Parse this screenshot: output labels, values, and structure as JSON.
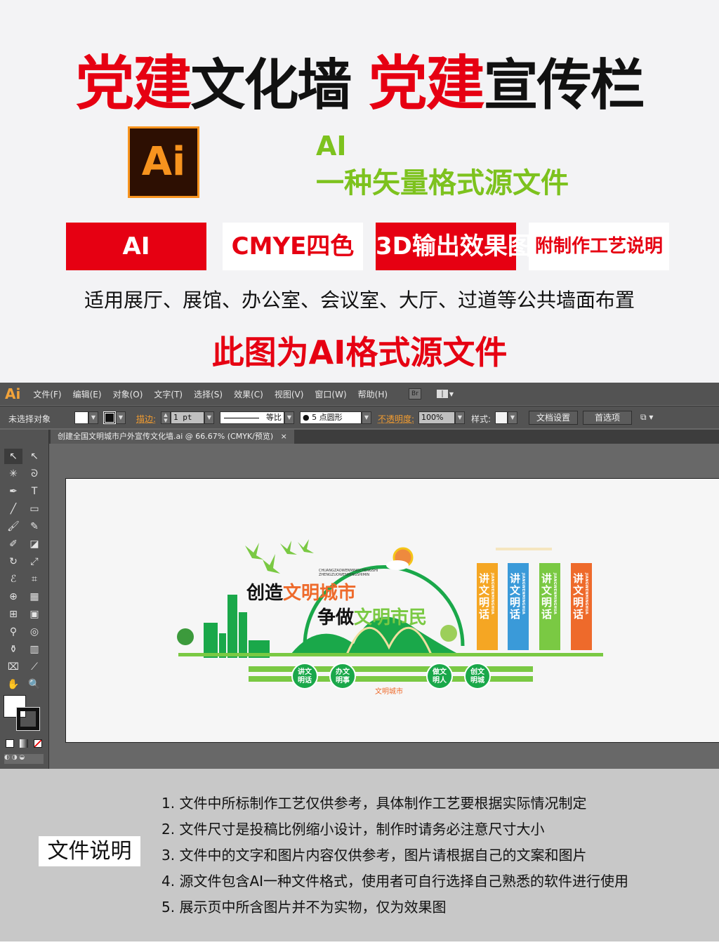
{
  "header": {
    "title_red1": "党建",
    "title_black1": "文化墙",
    "title_red2": "党建",
    "title_black2": "宣传栏"
  },
  "logo": {
    "text": "Ai"
  },
  "intro": {
    "line1": "AI",
    "line2": "一种矢量格式源文件"
  },
  "tags": [
    "AI",
    "CMYE四色",
    "3D输出效果图",
    "附制作工艺说明"
  ],
  "usage": "适用展厅、展馆、办公室、会议室、大厅、过道等公共墙面布置",
  "source_note": "此图为AI格式源文件",
  "illustrator": {
    "app_logo": "Ai",
    "menu": [
      "文件(F)",
      "编辑(E)",
      "对象(O)",
      "文字(T)",
      "选择(S)",
      "效果(C)",
      "视图(V)",
      "窗口(W)",
      "帮助(H)"
    ],
    "bridge": "Br",
    "control": {
      "selection": "未选择对象",
      "stroke_label": "描边:",
      "stroke_value": "1 pt",
      "stroke_profile": "等比",
      "brush": "5 点圆形",
      "opacity_label": "不透明度:",
      "opacity_value": "100%",
      "style_label": "样式:",
      "doc_setup": "文档设置",
      "preferences": "首选项"
    },
    "document_tab": "创建全国文明城市户外宣传文化墙.ai @ 66.67% (CMYK/预览)",
    "tab_close": "×"
  },
  "artwork": {
    "pinyin1": "CHUANGZAOWENMINGCHENGSHI",
    "pinyin2": "ZHENGZUOWENMINGSHIMIN",
    "slogan1_black": "创造",
    "slogan1_color": "文明城市",
    "slogan2_black": "争做",
    "slogan2_color": "文明市民",
    "panels": [
      {
        "text": "讲文明话",
        "color": "#f5a623"
      },
      {
        "text": "讲文明话",
        "color": "#3a9ad9"
      },
      {
        "text": "讲文明话",
        "color": "#7ac943"
      },
      {
        "text": "讲文明话",
        "color": "#ee6a2b"
      }
    ],
    "panel_pinyin": "JIANGWENMINGHUA",
    "circles": [
      "讲文明话",
      "办文明事",
      "做文明人",
      "创文明城"
    ],
    "caption": "文明城市",
    "colors": {
      "green": "#1aa84a",
      "light_green": "#7ac943",
      "orange": "#ee6a2b"
    }
  },
  "file_info": {
    "title": "文件说明",
    "notes": [
      "1. 文件中所标制作工艺仅供参考，具体制作工艺要根据实际情况制定",
      "2. 文件尺寸是投稿比例缩小设计，制作时请务必注意尺寸大小",
      "3. 文件中的文字和图片内容仅供参考，图片请根据自己的文案和图片",
      "4. 源文件包含AI一种文件格式，使用者可自行选择自己熟悉的软件进行使用",
      "5. 展示页中所含图片并不为实物，仅为效果图"
    ]
  }
}
